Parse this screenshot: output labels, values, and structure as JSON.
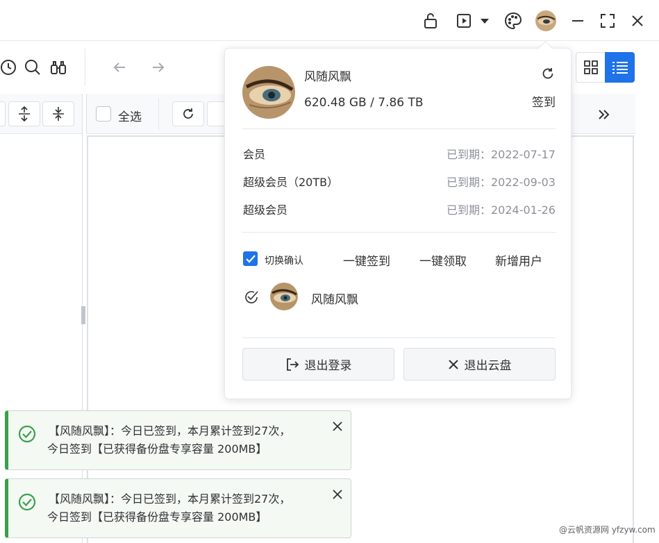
{
  "titlebar": {
    "icons": [
      "lock-icon",
      "play-icon",
      "caret-down-icon",
      "palette-icon",
      "avatar",
      "minimize-icon",
      "maximize-icon",
      "close-icon"
    ]
  },
  "toolbar": {
    "icons": [
      "clock-icon",
      "search-icon",
      "binoculars-icon",
      "back-arrow-icon",
      "forward-arrow-icon",
      "grid-view-icon",
      "list-view-icon"
    ]
  },
  "file_list": {
    "select_all_label": "全选"
  },
  "account_popover": {
    "username": "风随风飘",
    "storage": "620.48 GB / 7.86 TB",
    "signin_label": "签到",
    "memberships": [
      {
        "label": "会员",
        "status": "已到期：2022-07-17"
      },
      {
        "label": "超级会员（20TB）",
        "status": "已到期：2022-09-03"
      },
      {
        "label": "超级会员",
        "status": "已到期：2024-01-26"
      }
    ],
    "switch_confirm_label": "切换确认",
    "switch_confirm_checked": true,
    "actions": {
      "sign_all": "一键签到",
      "claim_all": "一键领取",
      "add_user": "新增用户"
    },
    "accounts": [
      {
        "name": "风随风飘"
      }
    ],
    "logout_label": "退出登录",
    "exit_label": "退出云盘"
  },
  "toasts": [
    {
      "line1": "【风随风飘】：今日已签到，本月累计签到27次，",
      "line2": "今日签到【已获得备份盘专享容量 200MB】"
    },
    {
      "line1": "【风随风飘】：今日已签到，本月累计签到27次，",
      "line2": "今日签到【已获得备份盘专享容量 200MB】"
    }
  ],
  "watermark": "@云帆资源网 yfzyw.com",
  "colors": {
    "accent": "#1e73e8",
    "success": "#38a04b",
    "muted_text": "#8d9099"
  }
}
